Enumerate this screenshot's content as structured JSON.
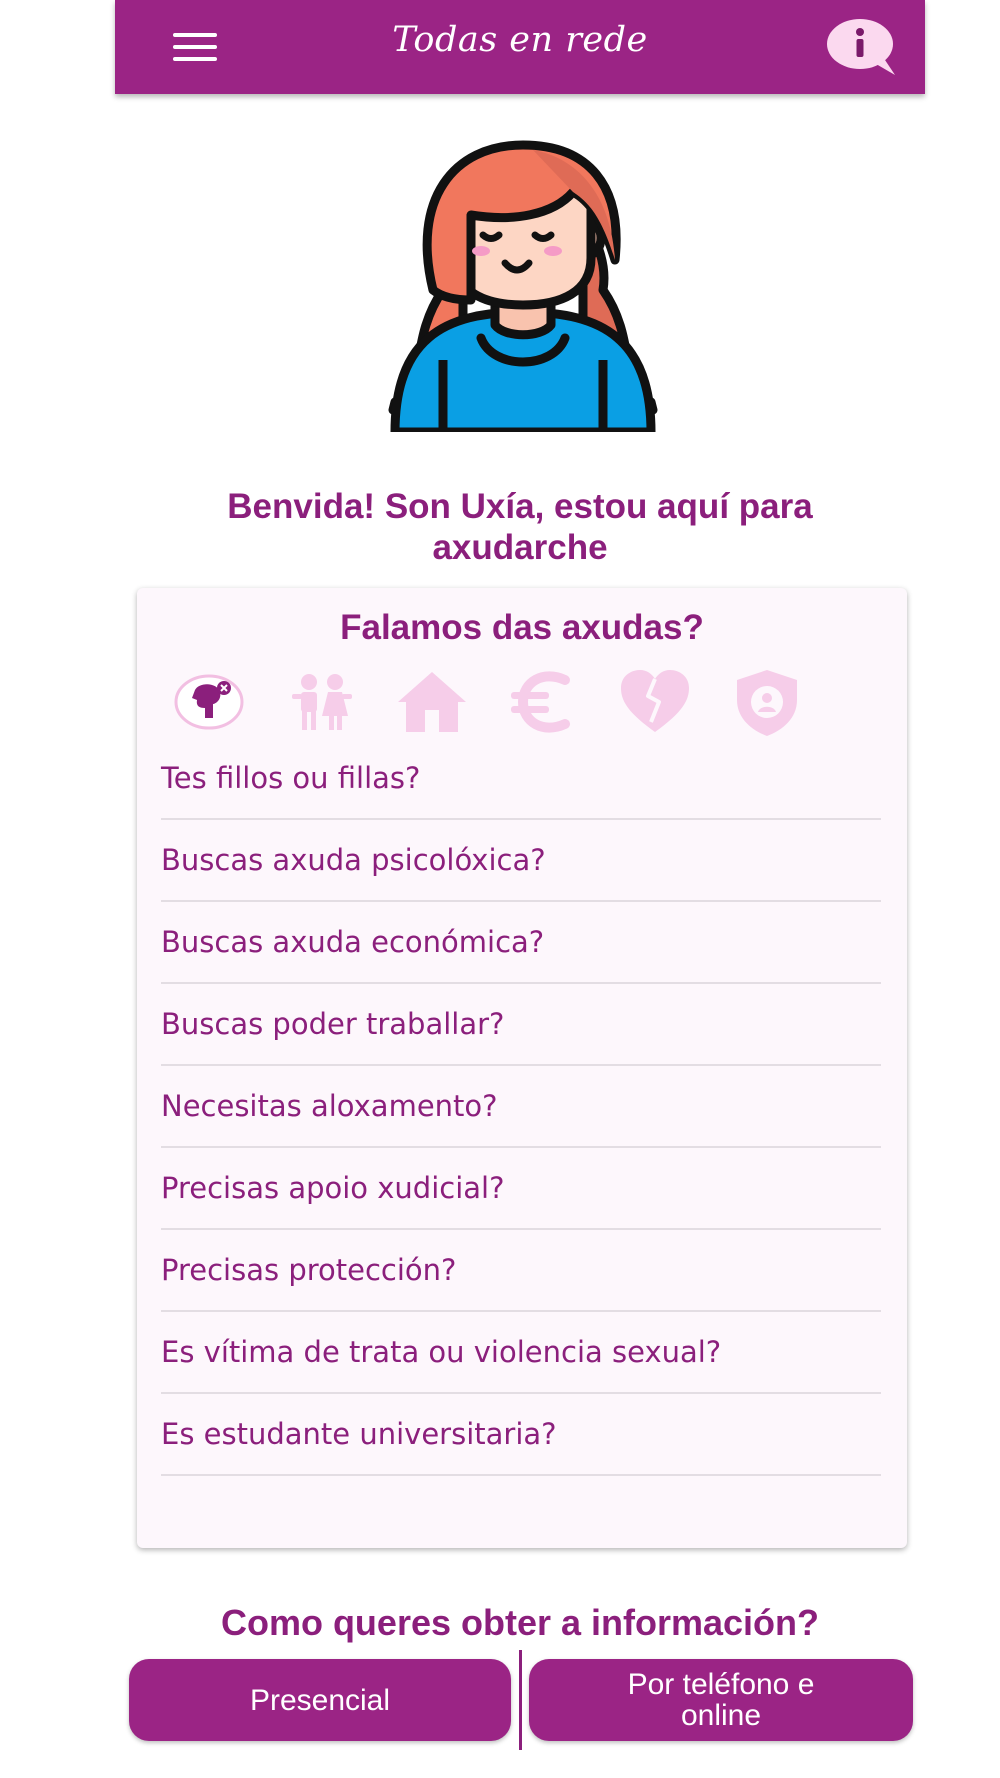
{
  "colors": {
    "primary": "#9b2485",
    "text": "#8b1f7c",
    "card": "#fdf7fc",
    "icon_inactive": "#f6cde9"
  },
  "header": {
    "title": "Todas en rede",
    "menu_icon": "hamburger-menu-icon",
    "info_icon": "info-speech-bubble-icon"
  },
  "welcome": {
    "line1": "Benvida! Son Uxía, estou aquí para",
    "line2": "axudarche"
  },
  "card": {
    "title": "Falamos das axudas?",
    "categories": [
      {
        "icon": "psychology-head-icon",
        "active": true
      },
      {
        "icon": "children-icon",
        "active": false
      },
      {
        "icon": "house-icon",
        "active": false
      },
      {
        "icon": "euro-icon",
        "active": false
      },
      {
        "icon": "broken-heart-icon",
        "active": false
      },
      {
        "icon": "protection-shield-icon",
        "active": false
      }
    ],
    "questions": [
      "Tes fillos ou fillas?",
      "Buscas axuda psicolóxica?",
      "Buscas axuda económica?",
      "Buscas poder traballar?",
      "Necesitas aloxamento?",
      "Precisas apoio xudicial?",
      "Precisas protección?",
      "Es vítima de trata ou violencia sexual?",
      "Es estudante universitaria?"
    ]
  },
  "contact": {
    "title": "Como queres obter a información?",
    "in_person": "Presencial",
    "phone_line1": "Por teléfono e",
    "phone_line2": "online"
  }
}
